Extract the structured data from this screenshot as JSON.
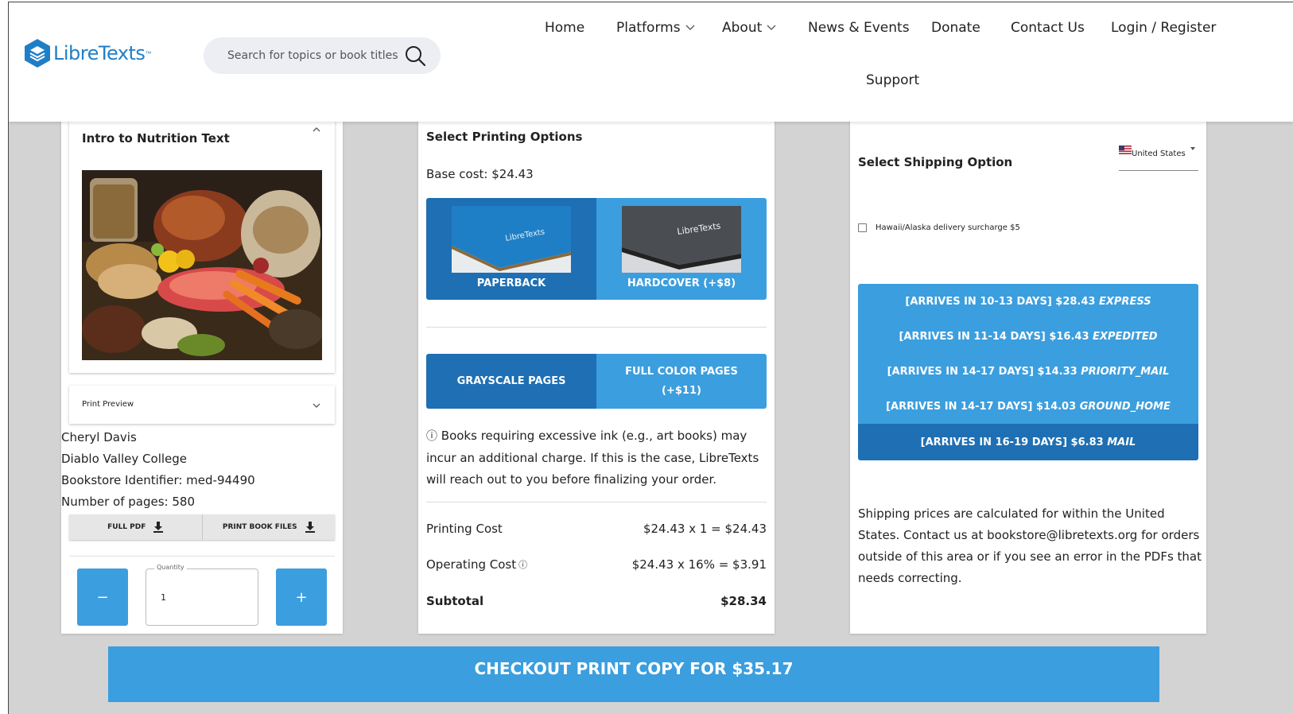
{
  "header": {
    "logo_text": "LibreTexts",
    "logo_tm": "™",
    "search_placeholder": "Search for topics or book titles",
    "nav": {
      "home": "Home",
      "platforms": "Platforms",
      "about": "About",
      "news": "News & Events",
      "donate": "Donate",
      "contact": "Contact Us",
      "login": "Login / Register",
      "support": "Support"
    }
  },
  "book": {
    "title": "Intro to Nutrition Text",
    "print_preview": "Print Preview",
    "author": "Cheryl Davis",
    "college": "Diablo Valley College",
    "identifier": "Bookstore Identifier: med-94490",
    "pages": "Number of pages: 580",
    "full_pdf": "FULL PDF",
    "print_files": "PRINT BOOK FILES",
    "quantity_label": "Quantity",
    "quantity_value": "1",
    "minus": "−",
    "plus": "+"
  },
  "printing": {
    "title": "Select Printing Options",
    "base_cost": "Base cost: $24.43",
    "cover_logo": "LibreTexts",
    "paperback": "PAPERBACK",
    "hardcover": "HARDCOVER (+$8)",
    "grayscale": "GRAYSCALE PAGES",
    "fullcolor_line1": "FULL COLOR PAGES",
    "fullcolor_line2": "(+$11)",
    "info_icon": "ⓘ",
    "note": "Books requiring excessive ink (e.g., art books) may incur an additional charge. If this is the case, LibreTexts will reach out to you before finalizing your order.",
    "printing_cost_label": "Printing Cost",
    "printing_cost_value": "$24.43 x 1 = $24.43",
    "operating_cost_label": "Operating Cost",
    "operating_cost_value": "$24.43 x 16% = $3.91",
    "subtotal_label": "Subtotal",
    "subtotal_value": "$28.34"
  },
  "shipping": {
    "title": "Select Shipping Option",
    "country": "United States",
    "surcharge_label": "Hawaii/Alaska delivery surcharge $5",
    "options": [
      {
        "prefix": "[ARRIVES IN 10-13 DAYS] $28.43 ",
        "method": "EXPRESS"
      },
      {
        "prefix": "[ARRIVES IN 11-14 DAYS] $16.43 ",
        "method": "EXPEDITED"
      },
      {
        "prefix": "[ARRIVES IN 14-17 DAYS] $14.33 ",
        "method": "PRIORITY_MAIL"
      },
      {
        "prefix": "[ARRIVES IN 14-17 DAYS] $14.03 ",
        "method": "GROUND_HOME"
      },
      {
        "prefix": "[ARRIVES IN 16-19 DAYS] $6.83 ",
        "method": "MAIL"
      }
    ],
    "note": "Shipping prices are calculated for within the United States. Contact us at bookstore@libretexts.org for orders outside of this area or if you see an error in the PDFs that needs correcting."
  },
  "checkout_label": "CHECKOUT PRINT COPY FOR $35.17",
  "colors": {
    "accent": "#3b9ede",
    "accent_dark": "#1e6fb3",
    "background": "#d3d3d3"
  }
}
